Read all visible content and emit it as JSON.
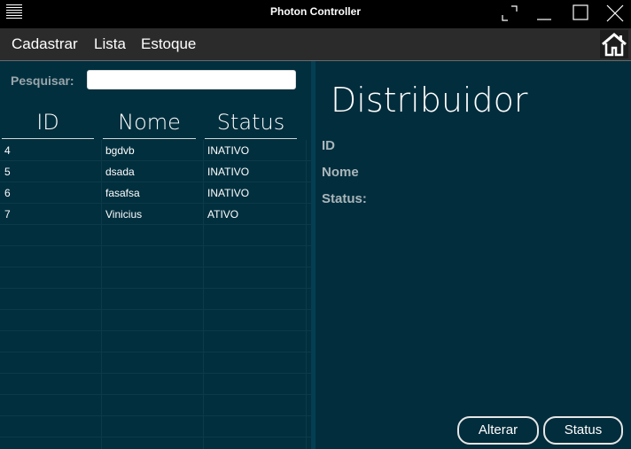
{
  "window": {
    "title": "Photon Controller"
  },
  "menu": {
    "items": [
      "Cadastrar",
      "Lista",
      "Estoque"
    ]
  },
  "search": {
    "label": "Pesquisar:",
    "value": "",
    "placeholder": ""
  },
  "table": {
    "columns": [
      "ID",
      "Nome",
      "Status"
    ],
    "rows": [
      {
        "id": "4",
        "nome": "bgdvb",
        "status": "INATIVO"
      },
      {
        "id": "5",
        "nome": "dsada",
        "status": "INATIVO"
      },
      {
        "id": "6",
        "nome": "fasafsa",
        "status": "INATIVO"
      },
      {
        "id": "7",
        "nome": "Vinicius",
        "status": "ATIVO"
      }
    ]
  },
  "detail": {
    "title": "Distribuidor",
    "labels": {
      "id": "ID",
      "nome": "Nome",
      "status": "Status:"
    }
  },
  "buttons": {
    "alterar": "Alterar",
    "status": "Status"
  },
  "colors": {
    "panel_bg": "#012f3e",
    "menu_bg": "#2b2b2b",
    "titlebar_bg": "#000000"
  }
}
